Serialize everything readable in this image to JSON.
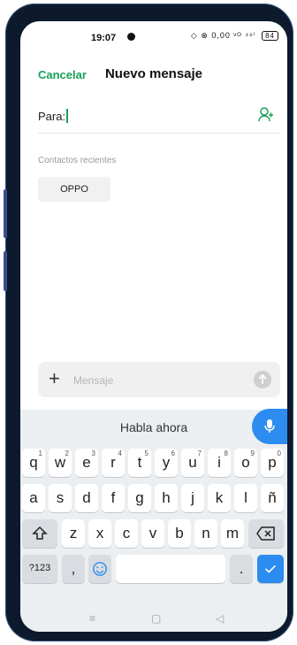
{
  "status_bar": {
    "time": "19:07",
    "right": "◇ ⊗ 0,00 ᵛᴼ ⁴⁶ⁱ"
  },
  "header": {
    "cancel_label": "Cancelar",
    "title": "Nuevo mensaje"
  },
  "recipient": {
    "label": "Para:",
    "value": ""
  },
  "recent": {
    "title": "Contactos recientes",
    "contacts": [
      "OPPO"
    ]
  },
  "composer": {
    "plus_label": "+",
    "placeholder": "Mensaje"
  },
  "keyboard": {
    "voice_label": "Habla ahora",
    "row1": [
      "q",
      "w",
      "e",
      "r",
      "t",
      "y",
      "u",
      "i",
      "o",
      "p"
    ],
    "row1_numbers": [
      "1",
      "2",
      "3",
      "4",
      "5",
      "6",
      "7",
      "8",
      "9",
      "0"
    ],
    "row2": [
      "a",
      "s",
      "d",
      "f",
      "g",
      "h",
      "j",
      "k",
      "l",
      "ñ"
    ],
    "row3": [
      "z",
      "x",
      "c",
      "v",
      "b",
      "n",
      "m"
    ],
    "symbols_label": "?123",
    "comma_label": ",",
    "period_label": "."
  },
  "colors": {
    "accent_green": "#19a05a",
    "keyboard_blue": "#2c8cf0"
  }
}
